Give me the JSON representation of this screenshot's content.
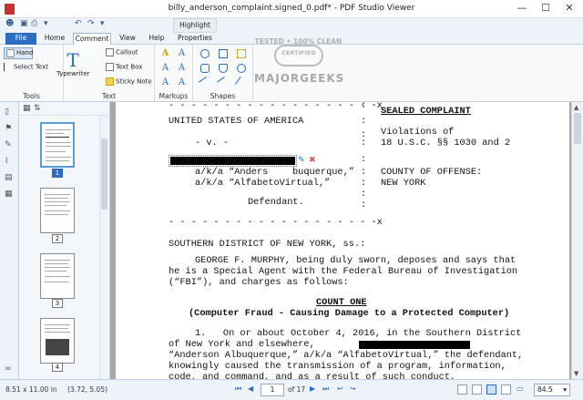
{
  "window": {
    "title": "billy_anderson_complaint.signed_0.pdf* - PDF Studio Viewer",
    "minimize": "—",
    "maximize": "☐",
    "close": "✕"
  },
  "qat": {
    "icons": [
      "app-menu-icon",
      "save-icon",
      "print-icon",
      "undo-icon",
      "redo-icon",
      "customize-icon"
    ]
  },
  "context_tab": "Highlight Area",
  "tabs": [
    "File",
    "Home",
    "Comment",
    "View",
    "Help",
    "Properties"
  ],
  "active_tab": "Comment",
  "ribbon": {
    "tools": {
      "label": "Tools",
      "hand": "Hand",
      "select_text": "Select Text"
    },
    "text": {
      "label": "Text",
      "typewriter": "Typewriter",
      "callout": "Callout",
      "text_box": "Text Box",
      "sticky_note": "Sticky Note"
    },
    "markups": {
      "label": "Markups"
    },
    "shapes": {
      "label": "Shapes"
    }
  },
  "watermark": {
    "line1": "TESTED • 100% CLEAN",
    "badge": "CERTIFIED",
    "line3": "MAJORGEEKS"
  },
  "thumbnails": {
    "pages": [
      "1",
      "2",
      "3",
      "4"
    ],
    "selected": "1"
  },
  "document": {
    "dashes_top": "- - - - - - - - - - - - - - - - - - -x",
    "party_left": "UNITED STATES OF AMERICA",
    "colon": ":",
    "sealed": "SEALED COMPLAINT",
    "versus": "- v. -",
    "violations": "Violations of",
    "usc": "18 U.S.C. §§ 1030 and 2",
    "aka1": "a/k/a “Anders",
    "aka1b": "buquerque,”",
    "county_label": "COUNTY OF OFFENSE:",
    "aka2": "a/k/a “AlfabetoVirtual,”",
    "county": "NEW YORK",
    "defendant": "Defendant.",
    "dashes_bottom": "- - - - - - - - - - - - - - - - - - -x",
    "district": "SOUTHERN DISTRICT OF NEW YORK, ss.:",
    "para1_l1": "GEORGE F. MURPHY, being duly sworn, deposes and says that",
    "para1_l2": "he is a Special Agent with the Federal Bureau of Investigation",
    "para1_l3": "(“FBI”), and charges as follows:",
    "count_one": "COUNT ONE",
    "count_desc": "(Computer Fraud - Causing Damage to a Protected Computer)",
    "para2_l1": "1.   On or about October 4, 2016, in the Southern District",
    "para2_l2": "of New York and elsewhere,",
    "para2_l3": "“Anderson Albuquerque,” a/k/a “AlfabetoVirtual,” the defendant,",
    "para2_l4": "knowingly caused the transmission of a program, information,",
    "para2_l5": "code, and command, and as a result of such conduct,"
  },
  "status": {
    "page_size": "8.51 x 11.00 in",
    "coords": "(3.72, 5.05)",
    "current_page": "1",
    "of_pages": "of 17",
    "zoom": "84.5"
  },
  "colors": {
    "accent": "#2b6cc4",
    "redaction": "#000000"
  }
}
